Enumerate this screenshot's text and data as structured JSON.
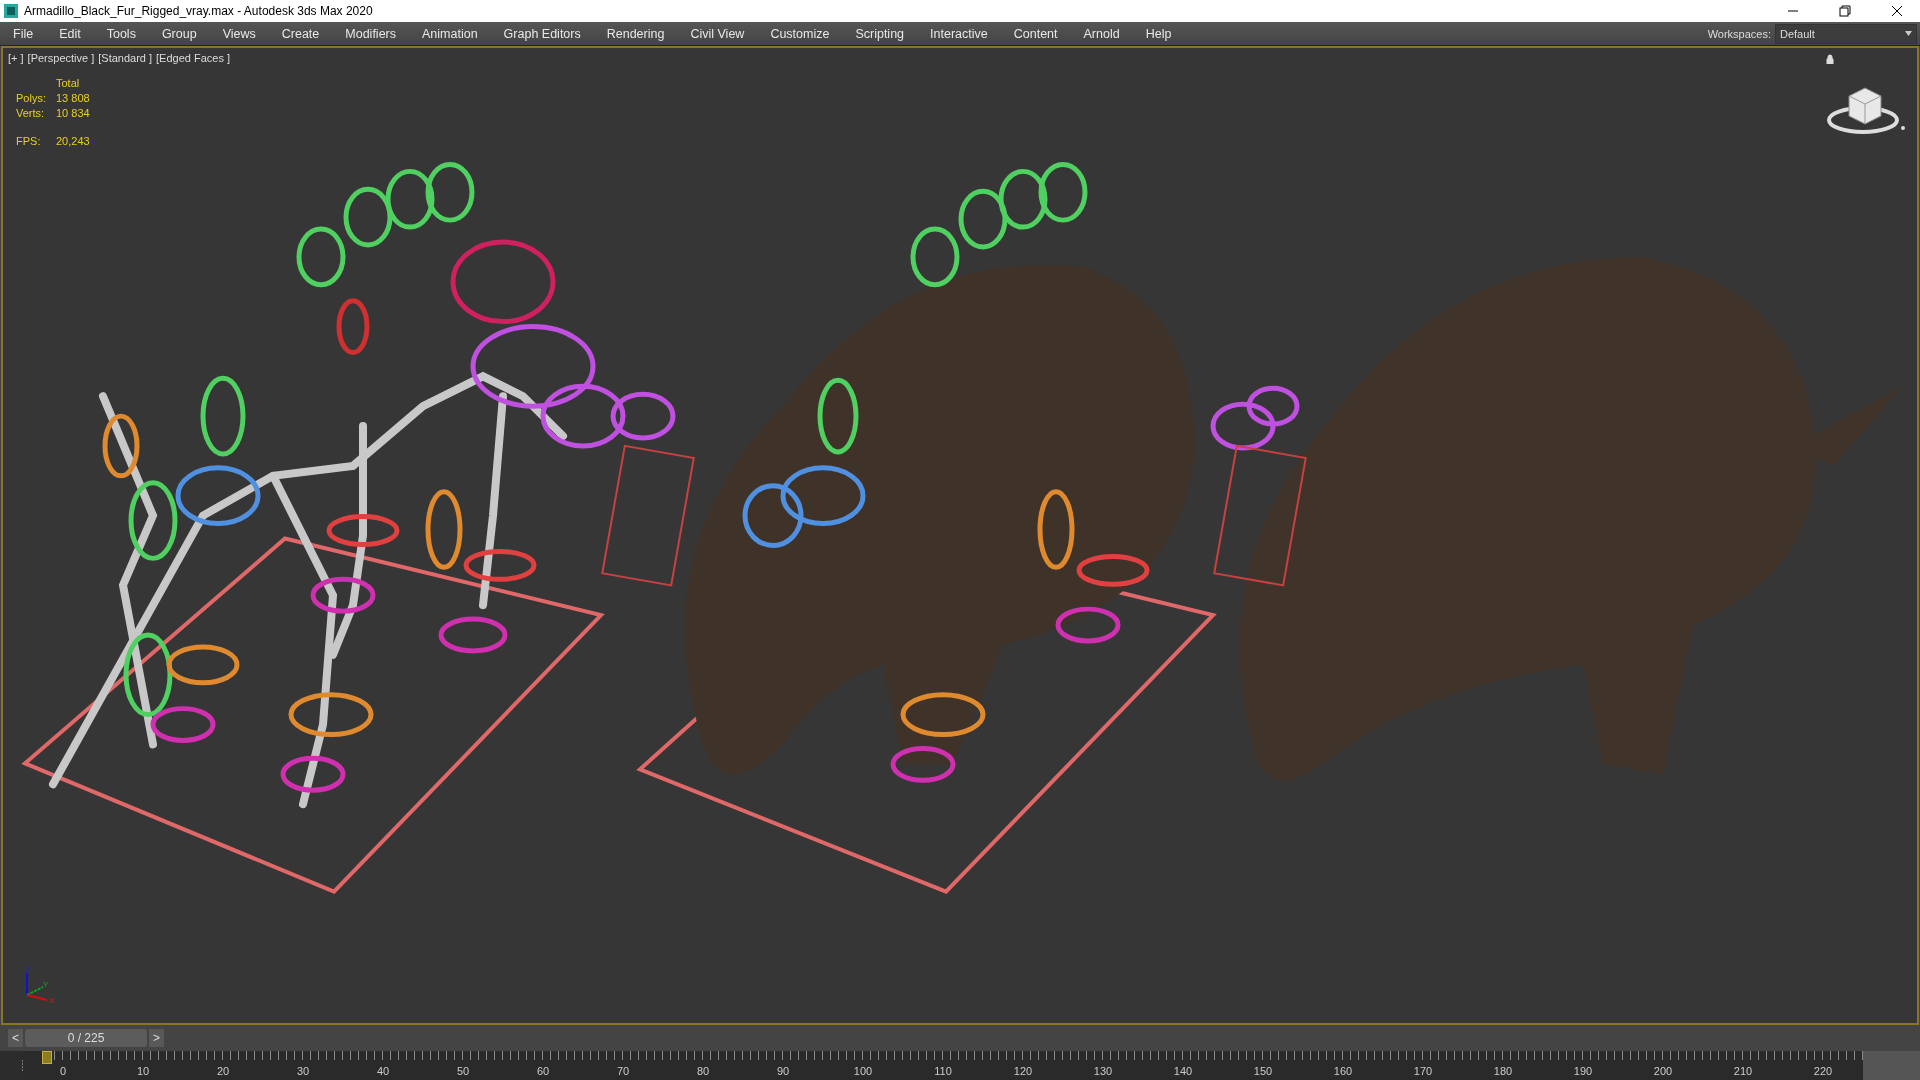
{
  "window": {
    "title": "Armadillo_Black_Fur_Rigged_vray.max - Autodesk 3ds Max 2020"
  },
  "menu": [
    {
      "label": "File"
    },
    {
      "label": "Edit"
    },
    {
      "label": "Tools"
    },
    {
      "label": "Group"
    },
    {
      "label": "Views"
    },
    {
      "label": "Create"
    },
    {
      "label": "Modifiers"
    },
    {
      "label": "Animation"
    },
    {
      "label": "Graph Editors"
    },
    {
      "label": "Rendering"
    },
    {
      "label": "Civil View"
    },
    {
      "label": "Customize"
    },
    {
      "label": "Scripting"
    },
    {
      "label": "Interactive"
    },
    {
      "label": "Content"
    },
    {
      "label": "Arnold"
    },
    {
      "label": "Help"
    }
  ],
  "workspaces": {
    "label": "Workspaces:",
    "value": "Default"
  },
  "viewport": {
    "labels": [
      "[+ ]",
      "[Perspective ]",
      "[Standard ]",
      "[Edged Faces ]"
    ],
    "stats": {
      "header": "Total",
      "rows": [
        {
          "label": "Polys:",
          "value": "13 808"
        },
        {
          "label": "Verts:",
          "value": "10 834"
        }
      ],
      "fps_label": "FPS:",
      "fps_value": "20,243"
    },
    "axes": {
      "x": "X",
      "y": "Y",
      "z": "Z"
    }
  },
  "timeline": {
    "prev": "<",
    "frame": "0 / 225",
    "next": ">",
    "level": 0,
    "ticks": [
      "0",
      "10",
      "20",
      "30",
      "40",
      "50",
      "60",
      "70",
      "80",
      "90",
      "100",
      "110",
      "120",
      "130",
      "140",
      "150",
      "160",
      "170",
      "180",
      "190",
      "200",
      "210",
      "220"
    ]
  }
}
